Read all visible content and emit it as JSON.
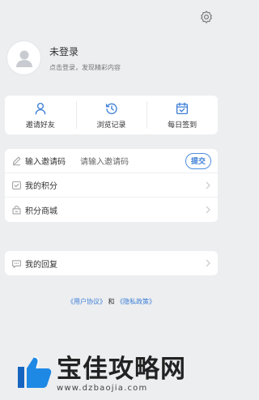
{
  "profile": {
    "name": "未登录",
    "subtitle": "点击登录，发现精彩内容"
  },
  "quick_actions": [
    {
      "label": "邀请好友",
      "icon": "user-icon"
    },
    {
      "label": "浏览记录",
      "icon": "history-icon"
    },
    {
      "label": "每日签到",
      "icon": "calendar-check-icon"
    }
  ],
  "invite": {
    "label": "输入邀请码",
    "placeholder": "请输入邀请码",
    "submit_label": "提交"
  },
  "menu": [
    {
      "label": "我的积分",
      "icon": "points-icon"
    },
    {
      "label": "积分商城",
      "icon": "shop-icon"
    }
  ],
  "replies": {
    "label": "我的回复",
    "icon": "comment-icon"
  },
  "agreement": {
    "user_agreement": "《用户协议》",
    "and": "和",
    "privacy_policy": "《隐私政策》"
  },
  "watermark": {
    "title": "宝佳攻略网",
    "url": "www.dzbaojia.com"
  },
  "colors": {
    "accent": "#3d7fd6",
    "background": "#eceef0",
    "watermark_logo": "#1e88e5"
  }
}
